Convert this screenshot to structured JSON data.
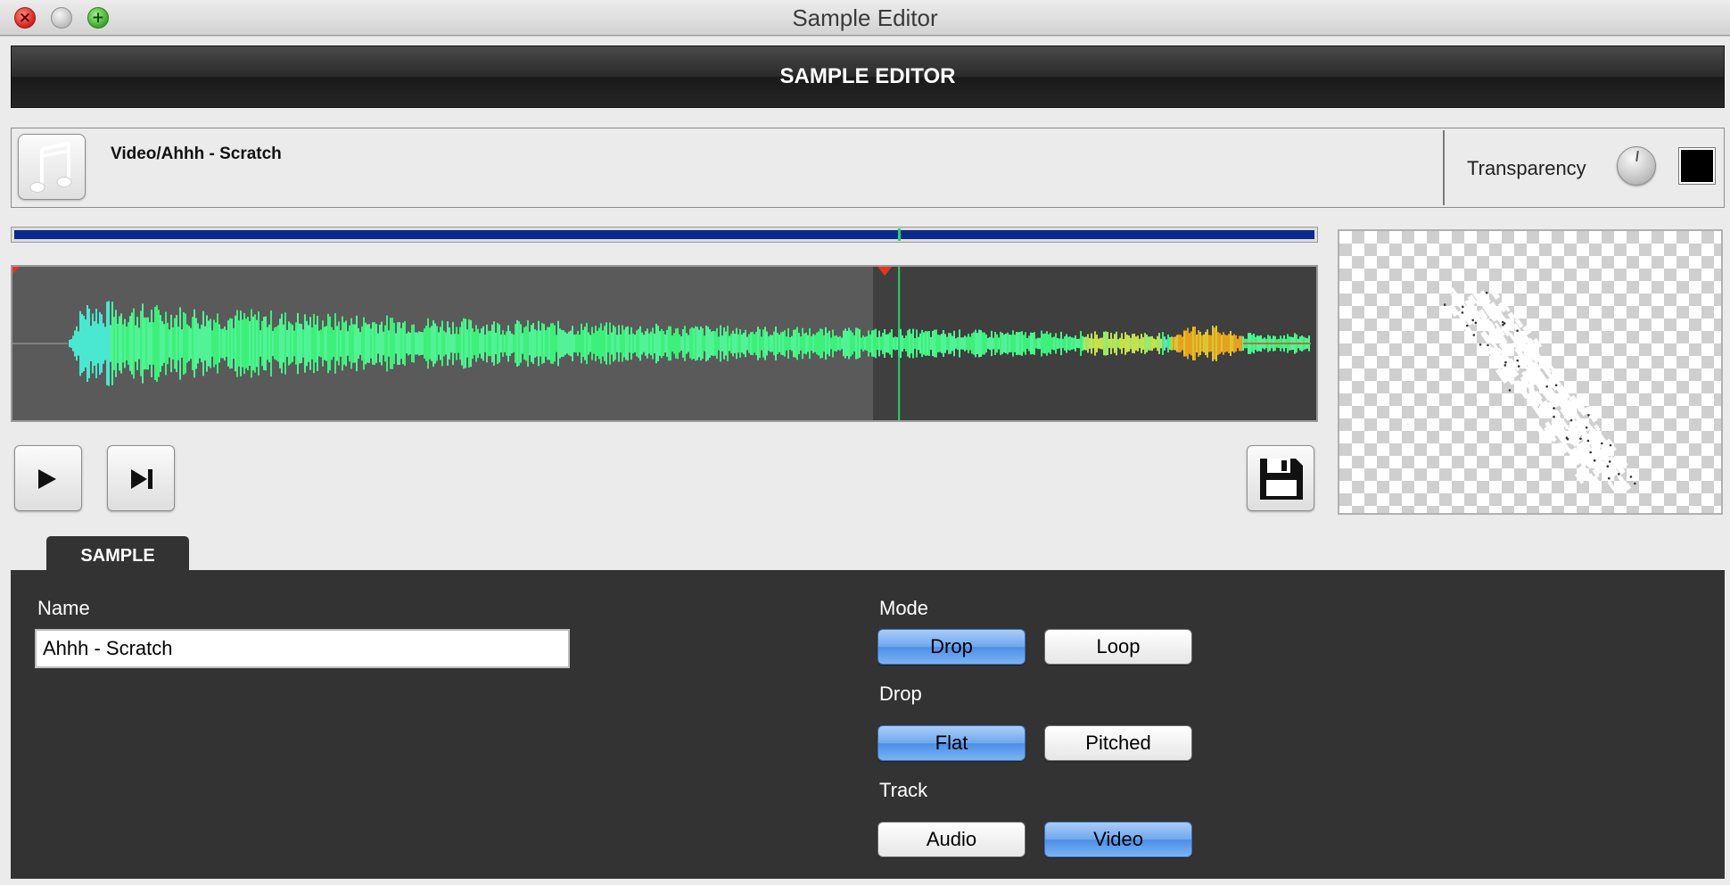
{
  "window": {
    "title": "Sample Editor",
    "close_glyph": "×",
    "max_glyph": "+"
  },
  "header": {
    "title": "SAMPLE EDITOR"
  },
  "info": {
    "sample_path": "Video/Ahhh - Scratch",
    "icon": "music-note-icon",
    "transparency_label": "Transparency",
    "transparency_color": "#000000"
  },
  "playback": {
    "position": 0.68,
    "selection_end": 0.66,
    "playhead": 0.68
  },
  "controls": {
    "play_icon": "play-icon",
    "next_icon": "skip-to-end-icon",
    "save_icon": "floppy-disk-save-icon"
  },
  "tabs": {
    "sample": "SAMPLE"
  },
  "sample": {
    "name_label": "Name",
    "name_value": "Ahhh - Scratch",
    "mode_label": "Mode",
    "mode_options": [
      "Drop",
      "Loop"
    ],
    "mode_selected": "Drop",
    "drop_label": "Drop",
    "drop_options": [
      "Flat",
      "Pitched"
    ],
    "drop_selected": "Flat",
    "track_label": "Track",
    "track_options": [
      "Audio",
      "Video"
    ],
    "track_selected": "Video"
  },
  "colors": {
    "accent_blue": "#4d8ee6",
    "scrubber": "#0b2a8c",
    "playhead": "#27d36b",
    "marker": "#e8321e"
  }
}
